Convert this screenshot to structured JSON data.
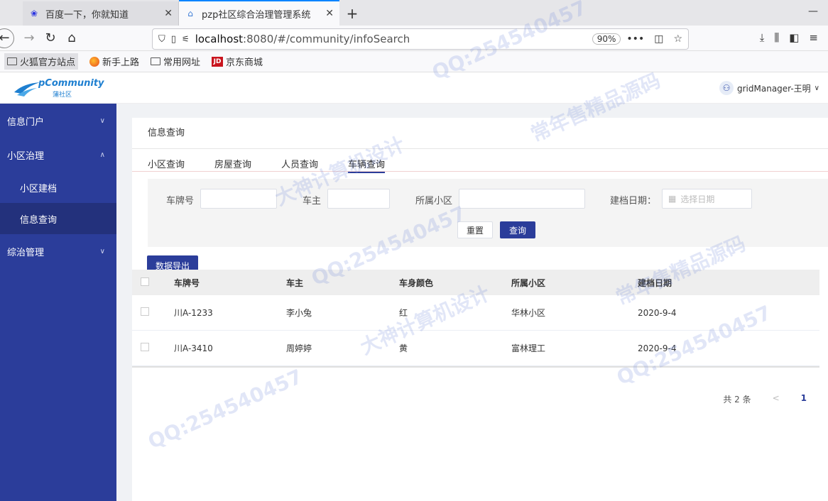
{
  "browser": {
    "tabs": [
      {
        "title": "百度一下，你就知道",
        "active": false
      },
      {
        "title": "pzp社区综合治理管理系统",
        "active": true
      }
    ],
    "url_host": "localhost",
    "url_path": ":8080/#/community/infoSearch",
    "zoom": "90%",
    "bookmarks": [
      "火狐官方站点",
      "新手上路",
      "常用网址",
      "京东商城"
    ]
  },
  "header": {
    "logo_text": "pCommunity",
    "logo_sub": "蒲社区",
    "user": "gridManager-王明"
  },
  "sidebar": {
    "items": [
      {
        "label": "信息门户"
      },
      {
        "label": "小区治理"
      },
      {
        "label": "小区建档"
      },
      {
        "label": "信息查询"
      },
      {
        "label": "综治管理"
      }
    ]
  },
  "page": {
    "title": "信息查询",
    "tabs": [
      {
        "label": "小区查询"
      },
      {
        "label": "房屋查询"
      },
      {
        "label": "人员查询"
      },
      {
        "label": "车辆查询"
      }
    ]
  },
  "filters": {
    "plate_label": "车牌号",
    "owner_label": "车主",
    "community_label": "所属小区",
    "date_label": "建档日期：",
    "date_placeholder": "选择日期",
    "reset": "重置",
    "search": "查询",
    "export": "数据导出"
  },
  "table": {
    "columns": [
      "车牌号",
      "车主",
      "车身颜色",
      "所属小区",
      "建档日期"
    ],
    "rows": [
      [
        "川A-1233",
        "李小兔",
        "红",
        "华林小区",
        "2020-9-4"
      ],
      [
        "川A-3410",
        "周婷婷",
        "黄",
        "富林理工",
        "2020-9-4"
      ]
    ]
  },
  "pager": {
    "total": "共 2 条",
    "prev": "<",
    "page": "1"
  },
  "watermark": {
    "texts": [
      "QQ:254540457",
      "常年售精品源码",
      "大神计算机设计"
    ]
  }
}
